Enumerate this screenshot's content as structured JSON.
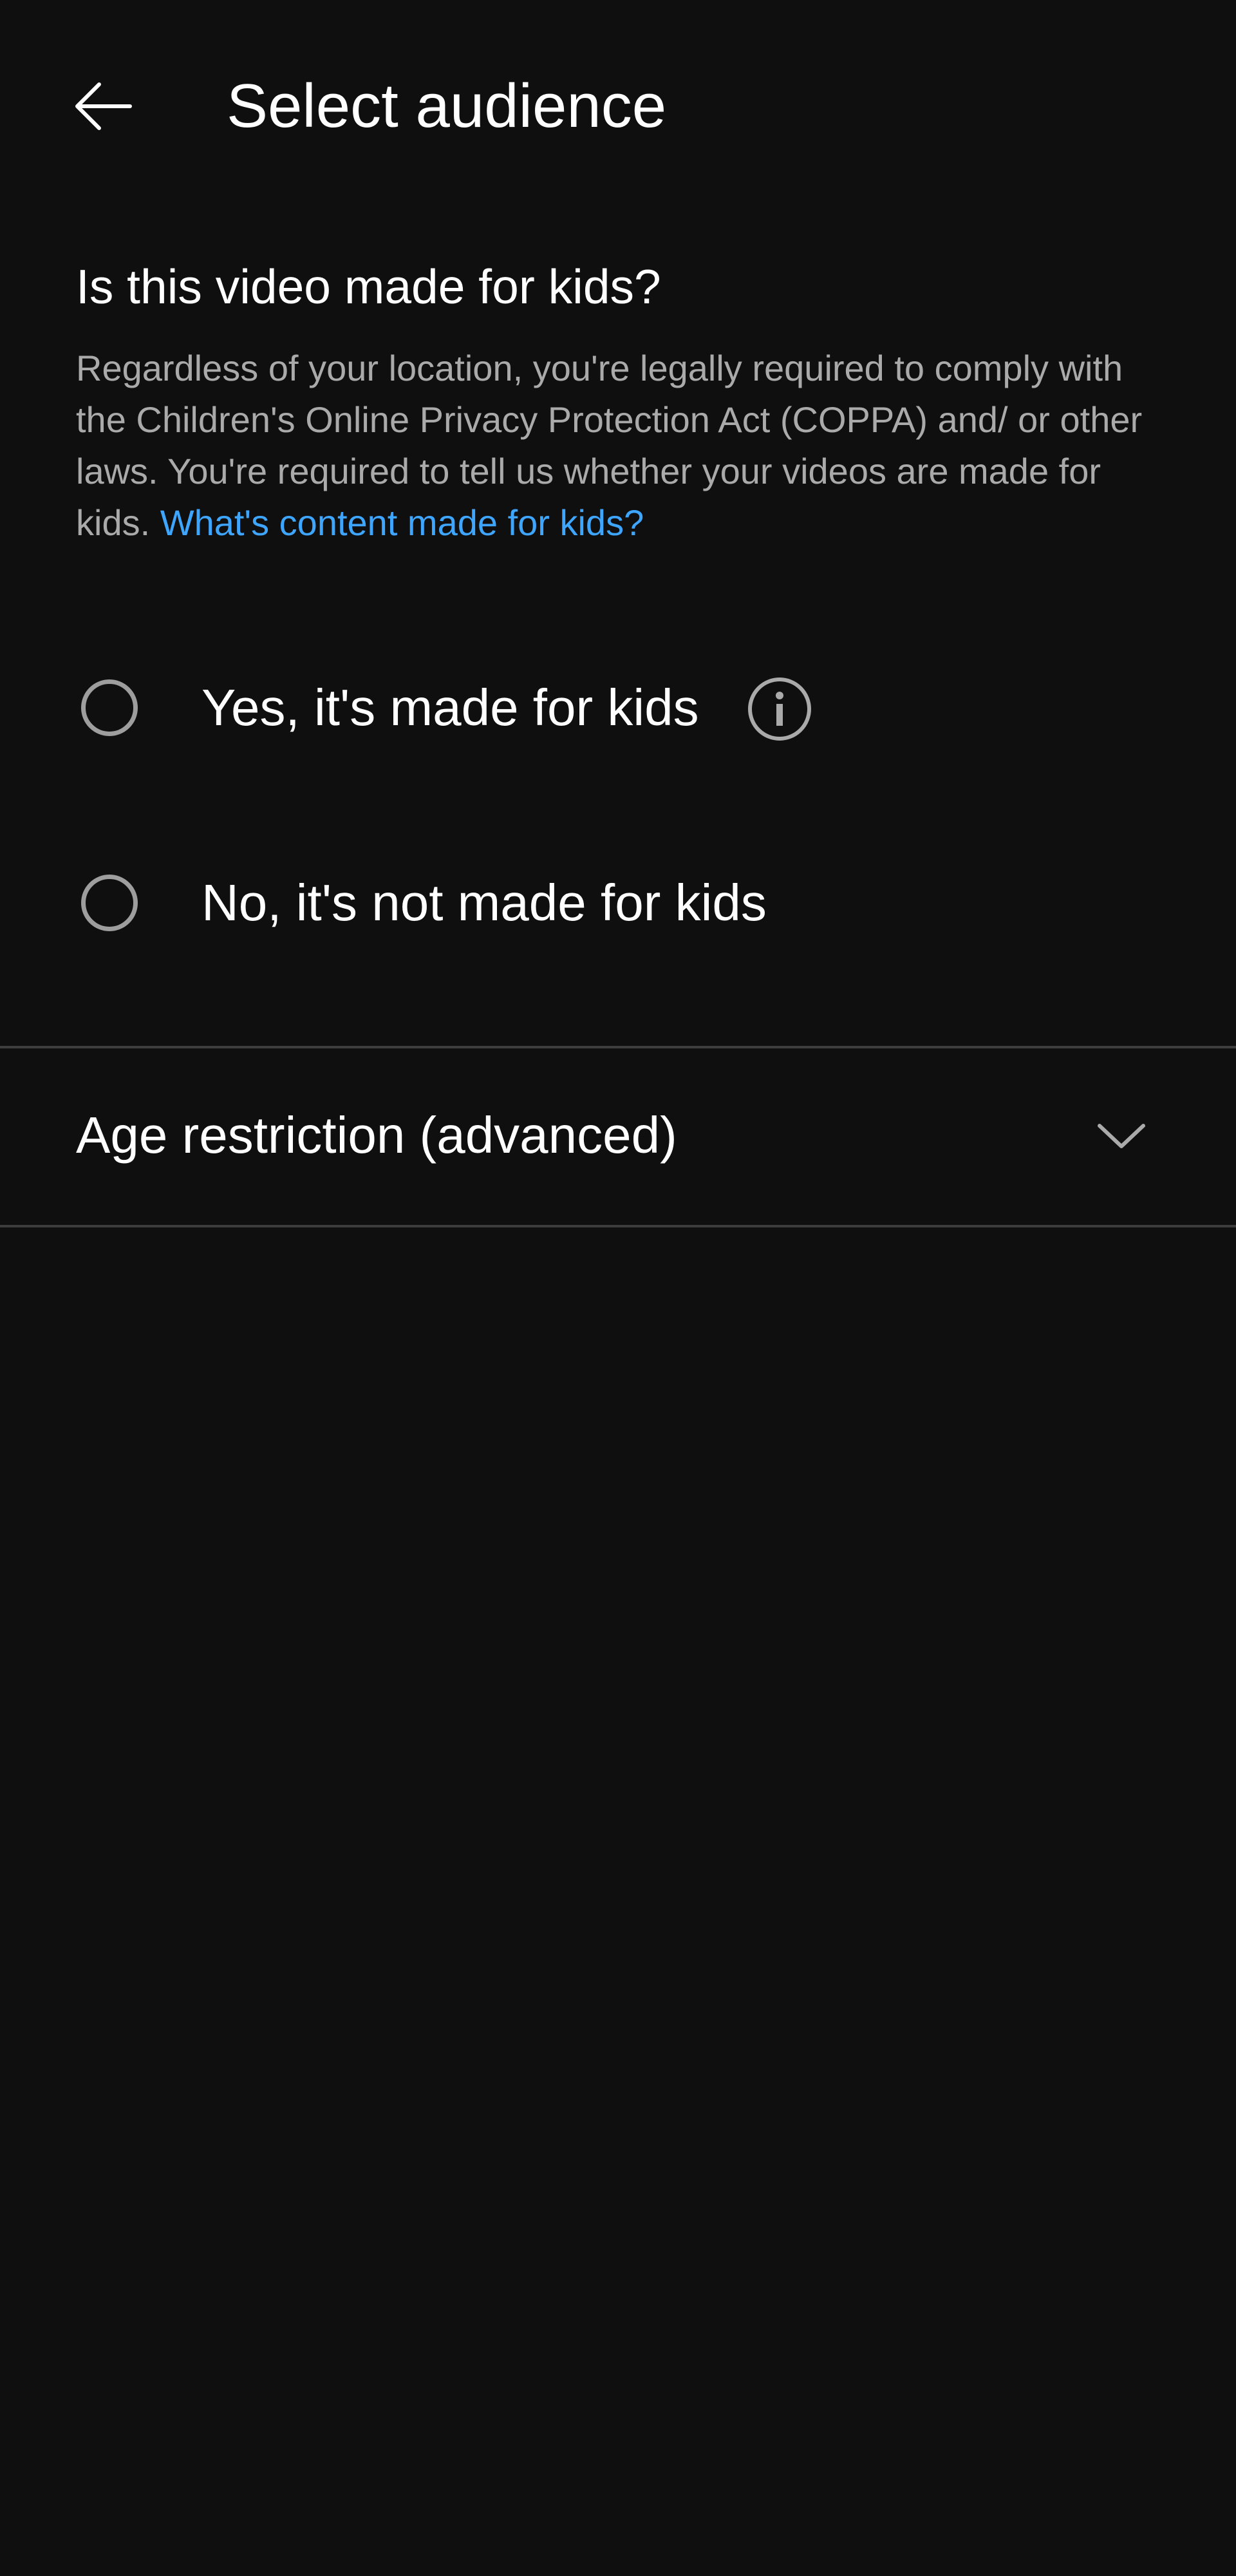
{
  "header": {
    "title": "Select audience",
    "back_icon": "arrow-left-icon"
  },
  "audience": {
    "question": "Is this video made for kids?",
    "description": "Regardless of your location, you're legally required to comply with the Children's Online Privacy Protection Act (COPPA) and/ or other laws. You're required to tell us whether your videos are made for kids.",
    "link_text": "What's content made for kids?",
    "link_color": "#3ea6ff",
    "options": [
      {
        "label": "Yes, it's made for kids",
        "selected": false,
        "has_info": true,
        "info_icon": "info-icon"
      },
      {
        "label": "No, it's not made for kids",
        "selected": false,
        "has_info": false
      }
    ]
  },
  "age_restriction": {
    "label": "Age restriction (advanced)",
    "expanded": false,
    "icon": "chevron-down-icon"
  },
  "colors": {
    "background": "#0f0f0f",
    "primary_text": "#ffffff",
    "secondary_text": "#aaaaaa",
    "radio_border": "#9e9e9e",
    "divider": "#3d3d3d"
  }
}
